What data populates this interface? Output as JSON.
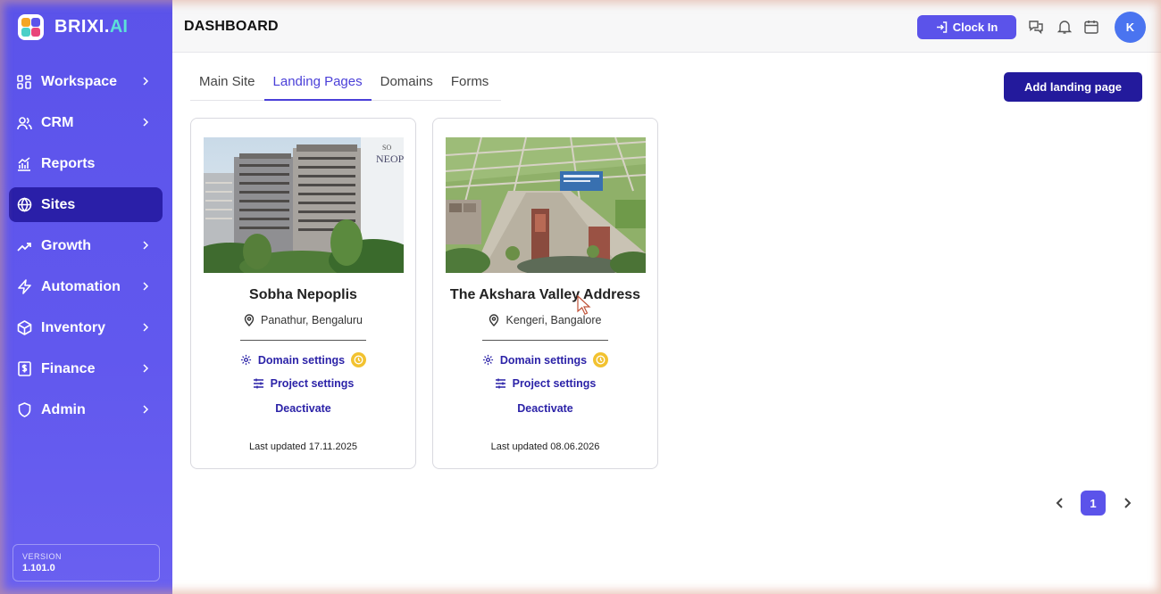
{
  "brand": {
    "name": "BRIXI.",
    "suffix": "AI"
  },
  "sidebar": {
    "items": [
      {
        "label": "Workspace",
        "icon": "grid-icon",
        "chevron": true
      },
      {
        "label": "CRM",
        "icon": "users-icon",
        "chevron": true
      },
      {
        "label": "Reports",
        "icon": "chart-icon",
        "chevron": false
      },
      {
        "label": "Sites",
        "icon": "globe-icon",
        "chevron": false,
        "active": true
      },
      {
        "label": "Growth",
        "icon": "trend-up-icon",
        "chevron": true
      },
      {
        "label": "Automation",
        "icon": "lightning-icon",
        "chevron": true
      },
      {
        "label": "Inventory",
        "icon": "box-icon",
        "chevron": true
      },
      {
        "label": "Finance",
        "icon": "dollar-doc-icon",
        "chevron": true
      },
      {
        "label": "Admin",
        "icon": "shield-icon",
        "chevron": true
      }
    ],
    "version_label": "VERSION",
    "version_value": "1.101.0"
  },
  "header": {
    "title": "DASHBOARD",
    "clock_in_label": "Clock In",
    "avatar_initial": "K"
  },
  "tabs": [
    {
      "label": "Main Site",
      "active": false
    },
    {
      "label": "Landing Pages",
      "active": true
    },
    {
      "label": "Domains",
      "active": false
    },
    {
      "label": "Forms",
      "active": false
    }
  ],
  "add_button_label": "Add landing page",
  "cards": [
    {
      "title": "Sobha Nepoplis",
      "location": "Panathur, Bengaluru",
      "domain_settings": "Domain settings",
      "project_settings": "Project settings",
      "deactivate": "Deactivate",
      "updated": "Last updated 17.11.2025",
      "image_text": "SO NEOP"
    },
    {
      "title": "The Akshara Valley Address",
      "location": "Kengeri, Bangalore",
      "domain_settings": "Domain settings",
      "project_settings": "Project settings",
      "deactivate": "Deactivate",
      "updated": "Last updated 08.06.2026"
    }
  ],
  "pagination": {
    "current": "1"
  },
  "colors": {
    "sidebar": "#5b53ea",
    "active_nav": "#2a1fa8",
    "primary_button": "#231a9c",
    "link": "#2c23a8",
    "badge": "#f2c230"
  }
}
